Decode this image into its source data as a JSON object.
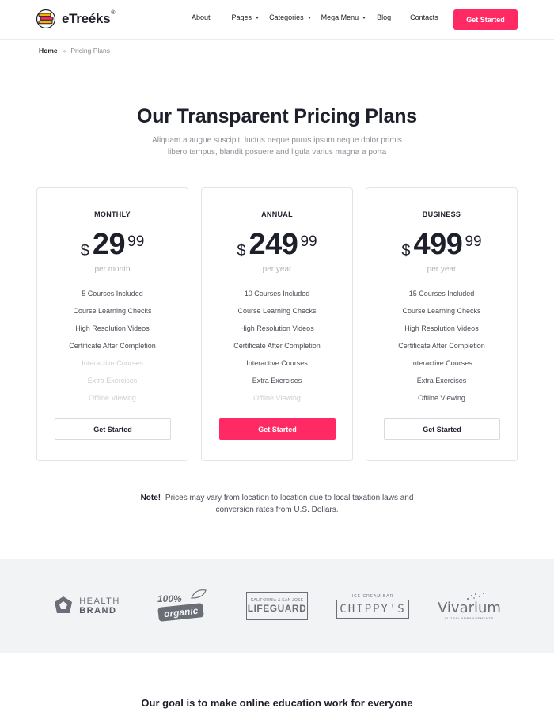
{
  "header": {
    "logo_text": "eTreéks",
    "logo_reg": "®",
    "nav": [
      {
        "label": "About",
        "has_dropdown": false
      },
      {
        "label": "Pages",
        "has_dropdown": true
      },
      {
        "label": "Categories",
        "has_dropdown": true
      },
      {
        "label": "Mega Menu",
        "has_dropdown": true
      },
      {
        "label": "Blog",
        "has_dropdown": false
      },
      {
        "label": "Contacts",
        "has_dropdown": false
      }
    ],
    "cta_label": "Get Started"
  },
  "breadcrumb": {
    "home": "Home",
    "separator": "»",
    "current": "Pricing Plans"
  },
  "pricing": {
    "title": "Our Transparent Pricing Plans",
    "subtitle": "Aliquam a augue suscipit, luctus neque purus ipsum neque dolor primis libero tempus, blandit posuere and ligula varius magna a porta",
    "plans": [
      {
        "name": "MONTHLY",
        "currency": "$",
        "amount": "29",
        "cents": "99",
        "period": "per month",
        "features": [
          {
            "label": "5 Courses Included",
            "included": true
          },
          {
            "label": "Course Learning Checks",
            "included": true
          },
          {
            "label": "High Resolution Videos",
            "included": true
          },
          {
            "label": "Certificate After Completion",
            "included": true
          },
          {
            "label": "Interactive Courses",
            "included": false
          },
          {
            "label": "Extra Exercises",
            "included": false
          },
          {
            "label": "Offline Viewing",
            "included": false
          }
        ],
        "button": "Get Started",
        "highlighted": false
      },
      {
        "name": "ANNUAL",
        "currency": "$",
        "amount": "249",
        "cents": "99",
        "period": "per year",
        "features": [
          {
            "label": "10 Courses Included",
            "included": true
          },
          {
            "label": "Course Learning Checks",
            "included": true
          },
          {
            "label": "High Resolution Videos",
            "included": true
          },
          {
            "label": "Certificate After Completion",
            "included": true
          },
          {
            "label": "Interactive Courses",
            "included": true
          },
          {
            "label": "Extra Exercises",
            "included": true
          },
          {
            "label": "Offline Viewing",
            "included": false
          }
        ],
        "button": "Get Started",
        "highlighted": true
      },
      {
        "name": "BUSINESS",
        "currency": "$",
        "amount": "499",
        "cents": "99",
        "period": "per year",
        "features": [
          {
            "label": "15 Courses Included",
            "included": true
          },
          {
            "label": "Course Learning Checks",
            "included": true
          },
          {
            "label": "High Resolution Videos",
            "included": true
          },
          {
            "label": "Certificate After Completion",
            "included": true
          },
          {
            "label": "Interactive Courses",
            "included": true
          },
          {
            "label": "Extra Exercises",
            "included": true
          },
          {
            "label": "Offline Viewing",
            "included": true
          }
        ],
        "button": "Get Started",
        "highlighted": false
      }
    ]
  },
  "note": {
    "label": "Note!",
    "text": "Prices may vary from location to location due to local taxation laws and conversion rates from U.S. Dollars."
  },
  "brands": [
    {
      "name": "health-brand-logo",
      "line1": "HEALTH",
      "line2": "BRAND"
    },
    {
      "name": "organic-logo",
      "line1": "100%",
      "line2": "organic"
    },
    {
      "name": "lifeguard-logo",
      "line1": "CALIFORNIA & SAN JOSE",
      "line2": "LIFEGUARD"
    },
    {
      "name": "chippys-logo",
      "line1": "ICE CREAM BAR",
      "line2": "CHIPPY'S"
    },
    {
      "name": "vivarium-logo",
      "line1": "Vivarium",
      "line2": "FLORAL ARRANGEMENTS"
    }
  ],
  "goal": {
    "title": "Our goal is to make online education work for everyone"
  },
  "colors": {
    "accent": "#ff2a64",
    "text_dark": "#1d1f2b",
    "muted": "#8d8f97",
    "brands_bg": "#f1f3f5"
  }
}
